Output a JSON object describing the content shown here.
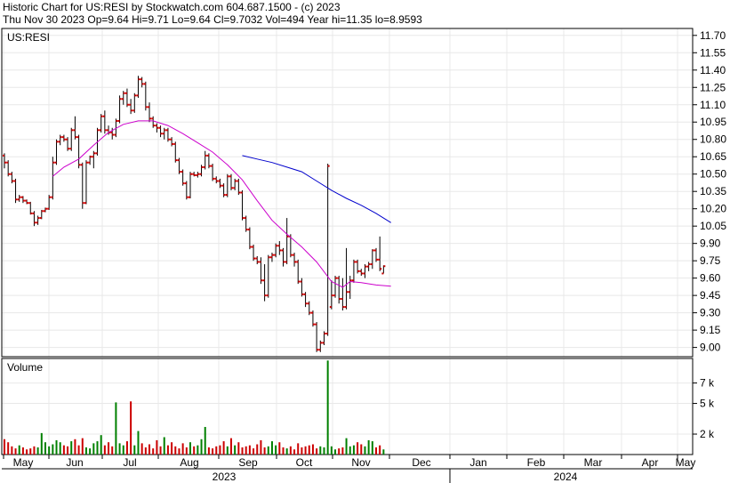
{
  "header": {
    "line1": "Historic Chart for US:RESI by Stockwatch.com 604.687.1500 - (c) 2023",
    "line2": "Thu Nov 30 2023  Op=9.64  Hi=9.71  Lo=9.64  Cl=9.7032  Vol=494  Year hi=11.35  lo=8.9593"
  },
  "chart_data": {
    "type": "ohlc",
    "symbol_label": "US:RESI",
    "volume_label": "Volume",
    "price_axis": {
      "ticks": [
        9.0,
        9.15,
        9.3,
        9.45,
        9.6,
        9.75,
        9.9,
        10.05,
        10.2,
        10.35,
        10.5,
        10.65,
        10.8,
        10.95,
        11.1,
        11.25,
        11.4,
        11.55,
        11.7
      ],
      "range": [
        8.92,
        11.76
      ]
    },
    "volume_axis": {
      "ticks": [
        "2 k",
        "5 k",
        "7 k"
      ],
      "tick_values": [
        2000,
        5000,
        7000
      ],
      "range": [
        0,
        9400
      ]
    },
    "months": [
      "May",
      "Jun",
      "Jul",
      "Aug",
      "Sep",
      "Oct",
      "Nov",
      "Dec",
      "Jan",
      "Feb",
      "Mar",
      "Apr",
      "May"
    ],
    "years": [
      "2023",
      "2024"
    ],
    "colors": {
      "up": "#008000",
      "down": "#cc0000",
      "bar": "#000000",
      "ma_short": "#cc00cc",
      "ma_long": "#0000cc",
      "grid": "#e8e8e8"
    },
    "ohlc": [
      [
        10.66,
        10.68,
        10.55,
        10.6
      ],
      [
        10.6,
        10.62,
        10.48,
        10.5
      ],
      [
        10.5,
        10.52,
        10.42,
        10.44
      ],
      [
        10.44,
        10.46,
        10.25,
        10.28
      ],
      [
        10.28,
        10.32,
        10.26,
        10.3
      ],
      [
        10.3,
        10.31,
        10.25,
        10.27
      ],
      [
        10.27,
        10.28,
        10.24,
        10.25
      ],
      [
        10.25,
        10.26,
        10.15,
        10.16
      ],
      [
        10.16,
        10.18,
        10.05,
        10.08
      ],
      [
        10.08,
        10.14,
        10.06,
        10.12
      ],
      [
        10.12,
        10.19,
        10.11,
        10.18
      ],
      [
        10.18,
        10.21,
        10.17,
        10.2
      ],
      [
        10.2,
        10.32,
        10.19,
        10.3
      ],
      [
        10.3,
        10.65,
        10.28,
        10.6
      ],
      [
        10.6,
        10.8,
        10.58,
        10.78
      ],
      [
        10.78,
        10.84,
        10.75,
        10.82
      ],
      [
        10.82,
        10.84,
        10.78,
        10.8
      ],
      [
        10.8,
        10.82,
        10.7,
        10.72
      ],
      [
        10.72,
        10.9,
        10.7,
        10.88
      ],
      [
        10.88,
        11.0,
        10.8,
        10.82
      ],
      [
        10.82,
        10.84,
        10.55,
        10.58
      ],
      [
        10.58,
        10.6,
        10.2,
        10.25
      ],
      [
        10.25,
        10.62,
        10.24,
        10.6
      ],
      [
        10.6,
        10.66,
        10.58,
        10.65
      ],
      [
        10.65,
        10.7,
        10.55,
        10.68
      ],
      [
        10.68,
        10.9,
        10.66,
        10.88
      ],
      [
        10.88,
        11.02,
        10.86,
        11.0
      ],
      [
        11.0,
        11.05,
        10.85,
        10.88
      ],
      [
        10.88,
        10.92,
        10.84,
        10.86
      ],
      [
        10.86,
        10.9,
        10.8,
        10.84
      ],
      [
        10.84,
        10.98,
        10.82,
        10.96
      ],
      [
        10.96,
        11.18,
        10.94,
        11.15
      ],
      [
        11.15,
        11.22,
        11.1,
        11.2
      ],
      [
        11.2,
        11.24,
        11.08,
        11.1
      ],
      [
        11.1,
        11.15,
        11.02,
        11.05
      ],
      [
        11.05,
        11.2,
        11.03,
        11.18
      ],
      [
        11.18,
        11.35,
        11.16,
        11.32
      ],
      [
        11.32,
        11.34,
        11.25,
        11.28
      ],
      [
        11.28,
        11.3,
        11.05,
        11.08
      ],
      [
        11.08,
        11.12,
        10.95,
        10.98
      ],
      [
        10.98,
        11.0,
        10.9,
        10.92
      ],
      [
        10.92,
        10.94,
        10.86,
        10.9
      ],
      [
        10.9,
        10.92,
        10.82,
        10.85
      ],
      [
        10.85,
        10.9,
        10.8,
        10.88
      ],
      [
        10.88,
        10.9,
        10.78,
        10.8
      ],
      [
        10.8,
        10.82,
        10.74,
        10.76
      ],
      [
        10.76,
        10.78,
        10.6,
        10.62
      ],
      [
        10.62,
        10.64,
        10.5,
        10.52
      ],
      [
        10.52,
        10.54,
        10.4,
        10.42
      ],
      [
        10.42,
        10.44,
        10.28,
        10.3
      ],
      [
        10.3,
        10.52,
        10.29,
        10.5
      ],
      [
        10.5,
        10.52,
        10.48,
        10.49
      ],
      [
        10.49,
        10.52,
        10.47,
        10.5
      ],
      [
        10.5,
        10.58,
        10.48,
        10.56
      ],
      [
        10.56,
        10.7,
        10.54,
        10.66
      ],
      [
        10.66,
        10.68,
        10.55,
        10.57
      ],
      [
        10.57,
        10.59,
        10.44,
        10.46
      ],
      [
        10.46,
        10.48,
        10.42,
        10.44
      ],
      [
        10.44,
        10.46,
        10.38,
        10.4
      ],
      [
        10.4,
        10.42,
        10.3,
        10.32
      ],
      [
        10.32,
        10.5,
        10.3,
        10.48
      ],
      [
        10.48,
        10.5,
        10.36,
        10.38
      ],
      [
        10.38,
        10.46,
        10.36,
        10.44
      ],
      [
        10.44,
        10.46,
        10.32,
        10.34
      ],
      [
        10.34,
        10.36,
        10.1,
        10.12
      ],
      [
        10.12,
        10.14,
        10.0,
        10.02
      ],
      [
        10.02,
        10.04,
        9.85,
        9.87
      ],
      [
        9.87,
        9.89,
        9.75,
        9.77
      ],
      [
        9.77,
        9.79,
        9.72,
        9.74
      ],
      [
        9.74,
        9.78,
        9.55,
        9.58
      ],
      [
        9.58,
        9.72,
        9.4,
        9.45
      ],
      [
        9.45,
        9.8,
        9.43,
        9.78
      ],
      [
        9.78,
        9.82,
        9.74,
        9.8
      ],
      [
        9.8,
        9.9,
        9.78,
        9.88
      ],
      [
        9.88,
        9.92,
        9.8,
        9.84
      ],
      [
        9.84,
        9.86,
        9.7,
        9.74
      ],
      [
        9.74,
        10.12,
        9.72,
        9.96
      ],
      [
        9.96,
        9.98,
        9.78,
        9.8
      ],
      [
        9.8,
        9.82,
        9.7,
        9.74
      ],
      [
        9.74,
        9.76,
        9.55,
        9.57
      ],
      [
        9.57,
        9.6,
        9.44,
        9.46
      ],
      [
        9.46,
        9.48,
        9.35,
        9.38
      ],
      [
        9.38,
        9.4,
        9.28,
        9.3
      ],
      [
        9.3,
        9.32,
        9.18,
        9.2
      ],
      [
        9.2,
        9.22,
        8.96,
        8.98
      ],
      [
        8.98,
        9.06,
        8.96,
        9.04
      ],
      [
        9.04,
        9.14,
        9.02,
        9.12
      ],
      [
        9.12,
        10.59,
        9.1,
        10.57
      ],
      [
        9.35,
        9.58,
        9.33,
        9.45
      ],
      [
        9.45,
        9.62,
        9.43,
        9.6
      ],
      [
        9.6,
        9.62,
        9.38,
        9.42
      ],
      [
        9.42,
        9.6,
        9.32,
        9.35
      ],
      [
        9.35,
        9.86,
        9.33,
        9.48
      ],
      [
        9.48,
        9.62,
        9.42,
        9.58
      ],
      [
        9.58,
        9.76,
        9.56,
        9.74
      ],
      [
        9.74,
        9.76,
        9.64,
        9.66
      ],
      [
        9.66,
        9.68,
        9.62,
        9.64
      ],
      [
        9.64,
        9.72,
        9.6,
        9.7
      ],
      [
        9.7,
        9.74,
        9.66,
        9.72
      ],
      [
        9.72,
        9.85,
        9.68,
        9.84
      ],
      [
        9.84,
        9.86,
        9.74,
        9.76
      ],
      [
        9.76,
        9.96,
        9.66,
        9.68
      ],
      [
        9.64,
        9.71,
        9.64,
        9.7032
      ]
    ],
    "volume": [
      1500,
      1200,
      800,
      600,
      900,
      700,
      500,
      600,
      800,
      700,
      2100,
      1200,
      800,
      1000,
      1400,
      1200,
      900,
      800,
      1300,
      1500,
      900,
      1600,
      700,
      600,
      1100,
      1300,
      1900,
      900,
      1200,
      800,
      5100,
      1100,
      900,
      1300,
      5200,
      900,
      2300,
      1100,
      700,
      1000,
      600,
      1400,
      800,
      1700,
      900,
      1200,
      800,
      600,
      1100,
      700,
      1200,
      800,
      900,
      1500,
      2700,
      700,
      600,
      800,
      900,
      1300,
      800,
      1600,
      900,
      1200,
      700,
      800,
      900,
      600,
      1000,
      1400,
      700,
      800,
      1300,
      900,
      1200,
      700,
      600,
      800,
      500,
      1100,
      700,
      800,
      900,
      1000,
      600,
      800,
      700,
      9200,
      800,
      500,
      600,
      700,
      1600,
      800,
      900,
      1200,
      1000,
      800,
      1400,
      1300,
      700,
      900,
      500
    ],
    "ma_short": [
      [
        13,
        10.48
      ],
      [
        16,
        10.56
      ],
      [
        20,
        10.63
      ],
      [
        24,
        10.75
      ],
      [
        28,
        10.86
      ],
      [
        32,
        10.93
      ],
      [
        36,
        10.96
      ],
      [
        40,
        10.96
      ],
      [
        44,
        10.92
      ],
      [
        48,
        10.85
      ],
      [
        52,
        10.77
      ],
      [
        56,
        10.69
      ],
      [
        60,
        10.58
      ],
      [
        64,
        10.45
      ],
      [
        68,
        10.27
      ],
      [
        72,
        10.1
      ],
      [
        76,
        9.98
      ],
      [
        80,
        9.87
      ],
      [
        84,
        9.74
      ],
      [
        88,
        9.57
      ],
      [
        91,
        9.52
      ],
      [
        93,
        9.57
      ],
      [
        96,
        9.56
      ],
      [
        100,
        9.54
      ],
      [
        104,
        9.53
      ]
    ],
    "ma_long": [
      [
        64,
        10.66
      ],
      [
        68,
        10.63
      ],
      [
        72,
        10.6
      ],
      [
        76,
        10.56
      ],
      [
        80,
        10.52
      ],
      [
        84,
        10.44
      ],
      [
        88,
        10.36
      ],
      [
        92,
        10.29
      ],
      [
        96,
        10.23
      ],
      [
        100,
        10.16
      ],
      [
        104,
        10.08
      ]
    ]
  }
}
